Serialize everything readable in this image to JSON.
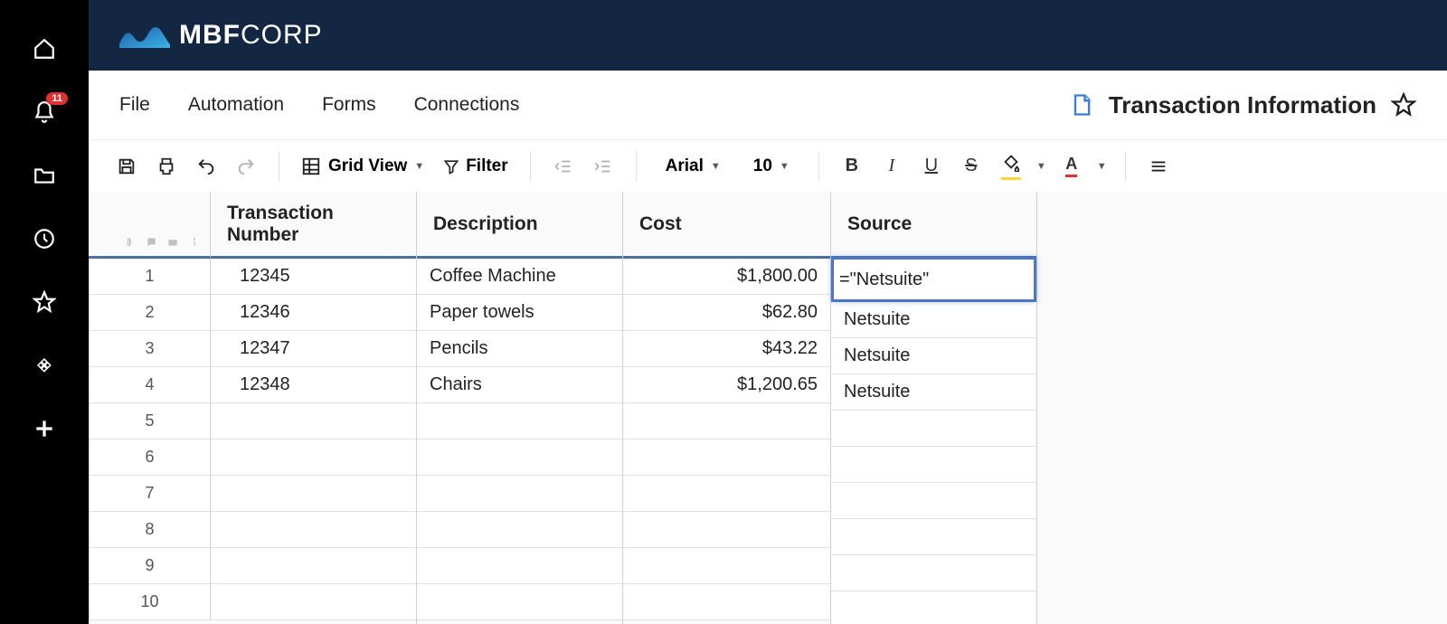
{
  "brand": {
    "bold": "MBF",
    "light": "CORP"
  },
  "leftRail": {
    "badge": "11"
  },
  "menus": [
    "File",
    "Automation",
    "Forms",
    "Connections"
  ],
  "sheetTitle": "Transaction Information",
  "toolbar": {
    "viewLabel": "Grid View",
    "filterLabel": "Filter",
    "font": "Arial",
    "fontSize": "10"
  },
  "columns": [
    "Transaction Number",
    "Description",
    "Cost",
    "Source"
  ],
  "rowNumbers": [
    "1",
    "2",
    "3",
    "4",
    "5",
    "6",
    "7",
    "8",
    "9",
    "10"
  ],
  "rows": [
    {
      "tx": "12345",
      "desc": "Coffee Machine",
      "cost": "$1,800.00",
      "src": "=\"Netsuite\"",
      "editing": true
    },
    {
      "tx": "12346",
      "desc": "Paper towels",
      "cost": "$62.80",
      "src": "Netsuite"
    },
    {
      "tx": "12347",
      "desc": "Pencils",
      "cost": "$43.22",
      "src": "Netsuite"
    },
    {
      "tx": "12348",
      "desc": "Chairs",
      "cost": "$1,200.65",
      "src": "Netsuite"
    },
    {
      "tx": "",
      "desc": "",
      "cost": "",
      "src": ""
    },
    {
      "tx": "",
      "desc": "",
      "cost": "",
      "src": ""
    },
    {
      "tx": "",
      "desc": "",
      "cost": "",
      "src": ""
    },
    {
      "tx": "",
      "desc": "",
      "cost": "",
      "src": ""
    },
    {
      "tx": "",
      "desc": "",
      "cost": "",
      "src": ""
    },
    {
      "tx": "",
      "desc": "",
      "cost": "",
      "src": ""
    }
  ]
}
